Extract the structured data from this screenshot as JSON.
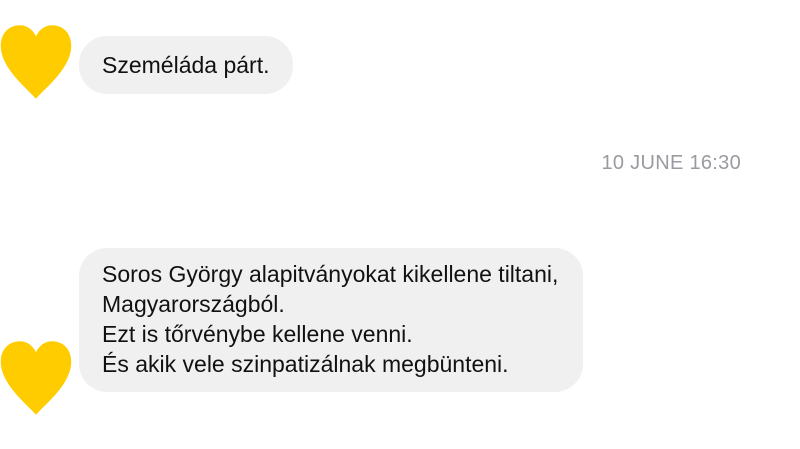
{
  "theme": {
    "heart_color": "#FFCC00",
    "bubble_color": "#F0F0F0",
    "timestamp_color": "#9A9AA0"
  },
  "messages": [
    {
      "avatar_icon": "yellow-heart-icon",
      "lines": [
        "Személáda párt."
      ]
    },
    {
      "avatar_icon": "yellow-heart-icon",
      "lines": [
        "Soros György alapitványokat kikellene tiltani,",
        "Magyarországból.",
        "Ezt is tőrvénybe kellene venni.",
        "És akik vele szinpatizálnak megbünteni."
      ]
    }
  ],
  "timestamp": "10 JUNE 16:30"
}
